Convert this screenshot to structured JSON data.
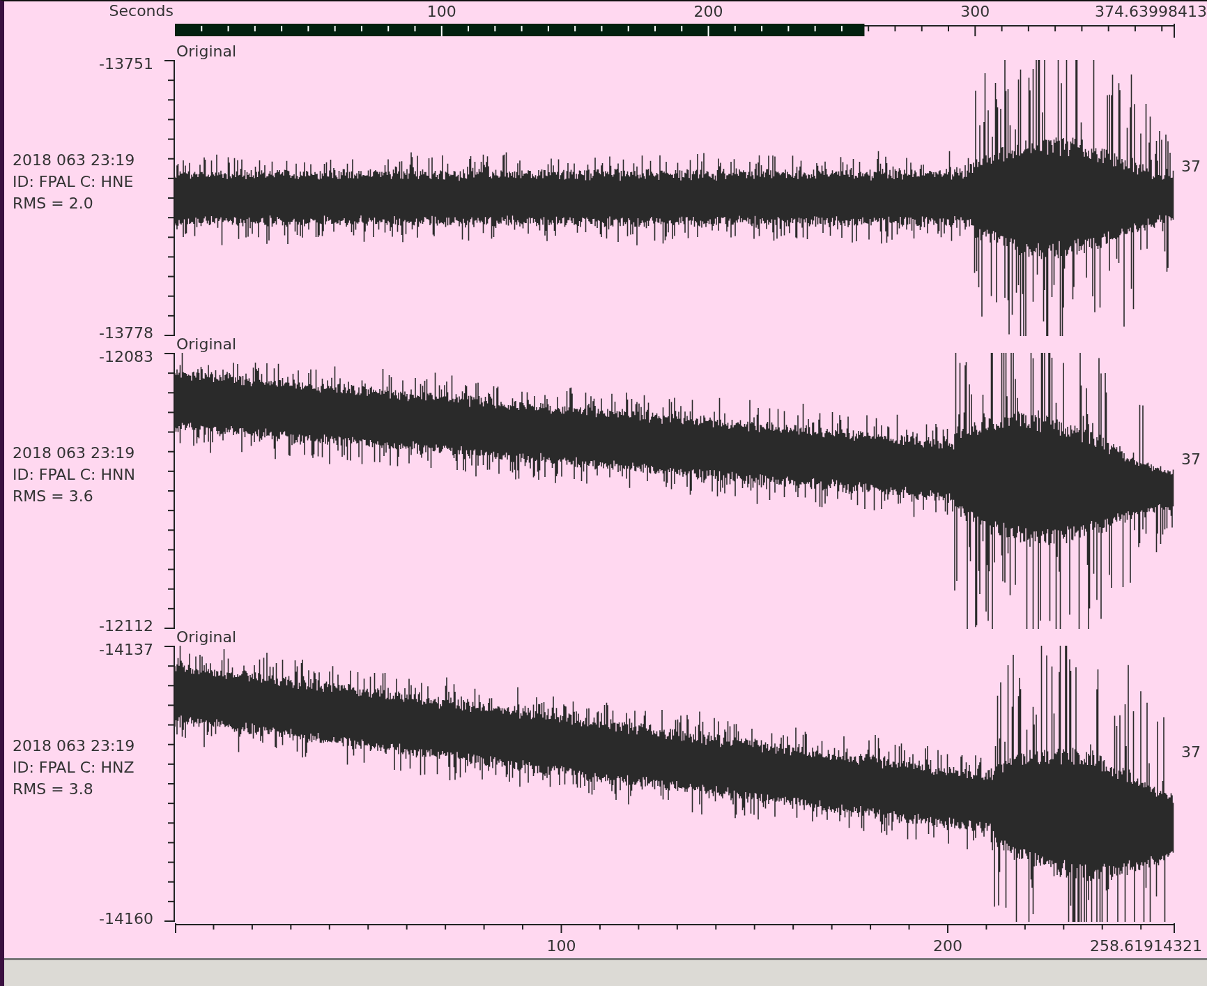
{
  "overview_axis": {
    "label": "Seconds",
    "ticks": [
      "100",
      "200",
      "300"
    ],
    "end_label": "374.63998413",
    "level": 0.69
  },
  "traces": [
    {
      "label": "Original",
      "max": "-13751",
      "min": "-13778",
      "time": "2018 063 23:19",
      "id_line": "ID: FPAL C: HNE",
      "rms": "RMS = 2.0",
      "right_label": "37"
    },
    {
      "label": "Original",
      "max": "-12083",
      "min": "-12112",
      "time": "2018 063 23:19",
      "id_line": "ID: FPAL C: HNN",
      "rms": "RMS = 3.6",
      "right_label": "37"
    },
    {
      "label": "Original",
      "max": "-14137",
      "min": "-14160",
      "time": "2018 063 23:19",
      "id_line": "ID: FPAL C: HNZ",
      "rms": "RMS = 3.8",
      "right_label": "37"
    }
  ],
  "time_axis": {
    "ticks": [
      "100",
      "200"
    ],
    "end_label": "258.61914321"
  }
}
